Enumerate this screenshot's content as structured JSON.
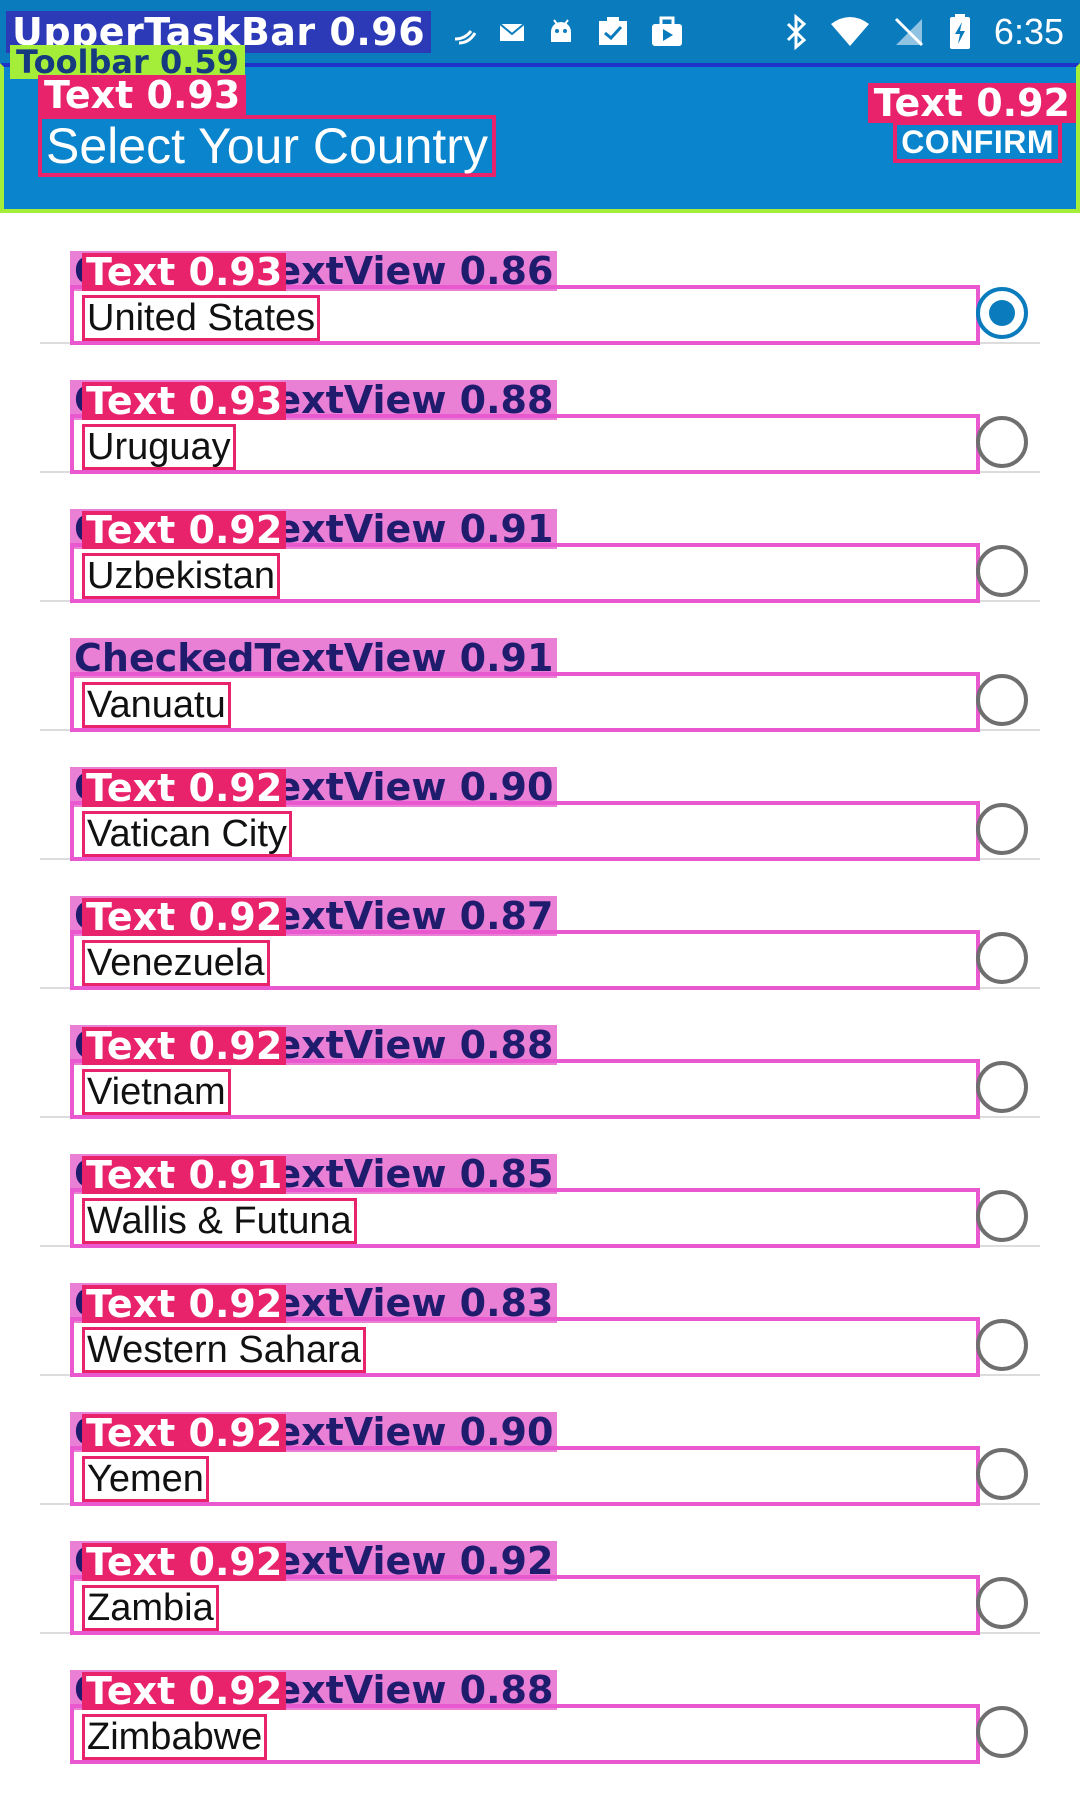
{
  "status_bar": {
    "overlay_label": "UpperTaskBar 0.96",
    "time": "6:35",
    "icons": [
      "wifi-calling-icon",
      "mail-icon",
      "android-icon",
      "clipboard-check-icon",
      "shopping-bag-icon",
      "bluetooth-icon",
      "wifi-icon",
      "no-sim-icon",
      "battery-charging-icon"
    ]
  },
  "toolbar": {
    "overlay_label": "Toolbar 0.59",
    "title": "Select Your Country",
    "title_overlay": "Text 0.93",
    "confirm_label": "CONFIRM",
    "confirm_overlay": "Text 0.92"
  },
  "colors": {
    "primary": "#0a84cc",
    "status_bar": "#0a7bbd",
    "radio_checked": "#0a7bbd",
    "radio_unchecked": "#6f6f6f"
  },
  "countries": [
    {
      "name": "United States",
      "checked": true,
      "cv_overlay": "CheckedTextView 0.86",
      "text_overlay": "Text 0.93"
    },
    {
      "name": "Uruguay",
      "checked": false,
      "cv_overlay": "CheckedTextView 0.88",
      "text_overlay": "Text 0.93"
    },
    {
      "name": "Uzbekistan",
      "checked": false,
      "cv_overlay": "CheckedTextView 0.91",
      "text_overlay": "Text 0.92"
    },
    {
      "name": "Vanuatu",
      "checked": false,
      "cv_overlay": "CheckedTextView 0.91",
      "text_overlay": ""
    },
    {
      "name": "Vatican City",
      "checked": false,
      "cv_overlay": "CheckedTextView 0.90",
      "text_overlay": "Text 0.92"
    },
    {
      "name": "Venezuela",
      "checked": false,
      "cv_overlay": "CheckedTextView 0.87",
      "text_overlay": "Text 0.92"
    },
    {
      "name": "Vietnam",
      "checked": false,
      "cv_overlay": "CheckedTextView 0.88",
      "text_overlay": "Text 0.92"
    },
    {
      "name": "Wallis & Futuna",
      "checked": false,
      "cv_overlay": "CheckedTextView 0.85",
      "text_overlay": "Text 0.91"
    },
    {
      "name": "Western Sahara",
      "checked": false,
      "cv_overlay": "CheckedTextView 0.83",
      "text_overlay": "Text 0.92"
    },
    {
      "name": "Yemen",
      "checked": false,
      "cv_overlay": "CheckedTextView 0.90",
      "text_overlay": "Text 0.92"
    },
    {
      "name": "Zambia",
      "checked": false,
      "cv_overlay": "CheckedTextView 0.92",
      "text_overlay": "Text 0.92"
    },
    {
      "name": "Zimbabwe",
      "checked": false,
      "cv_overlay": "CheckedTextView 0.88",
      "text_overlay": "Text 0.92"
    }
  ]
}
